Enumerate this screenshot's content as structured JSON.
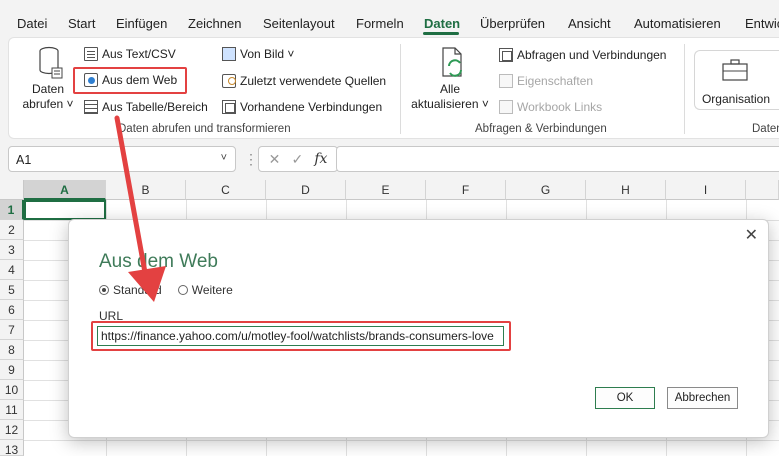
{
  "menu": {
    "tabs": [
      "Datei",
      "Start",
      "Einfügen",
      "Zeichnen",
      "Seitenlayout",
      "Formeln",
      "Daten",
      "Überprüfen",
      "Ansicht",
      "Automatisieren",
      "Entwic"
    ],
    "active": "Daten"
  },
  "ribbon": {
    "get_data": {
      "line1": "Daten",
      "line2": "abrufen ˅"
    },
    "from_text_csv": "Aus Text/CSV",
    "from_web": "Aus dem Web",
    "from_table": "Aus Tabelle/Bereich",
    "from_picture": "Von Bild ˅",
    "recent_sources": "Zuletzt verwendete Quellen",
    "existing_connections": "Vorhandene Verbindungen",
    "group1_label": "Daten abrufen und transformieren",
    "refresh_all": {
      "line1": "Alle",
      "line2": "aktualisieren ˅"
    },
    "queries_connections": "Abfragen und Verbindungen",
    "properties": "Eigenschaften",
    "workbook_links": "Workbook Links",
    "group2_label": "Abfragen & Verbindungen",
    "organisation": "Organisation",
    "group3_label": "Daten"
  },
  "formula_bar": {
    "name_box": "A1",
    "name_box_arrow": "˅",
    "cancel": "✕",
    "enter": "✓",
    "fx": "fx"
  },
  "grid": {
    "columns": [
      "A",
      "B",
      "C",
      "D",
      "E",
      "F",
      "G",
      "H",
      "I"
    ],
    "rows": [
      "1",
      "2",
      "3",
      "4",
      "5",
      "6",
      "7",
      "8",
      "9",
      "10",
      "11",
      "12",
      "13"
    ],
    "selected_cell": "A1"
  },
  "dialog": {
    "title": "Aus dem Web",
    "close": "✕",
    "radio_standard": "Standard",
    "radio_advanced": "Weitere",
    "url_label": "URL",
    "url_value": "https://finance.yahoo.com/u/motley-fool/watchlists/brands-consumers-love",
    "ok": "OK",
    "cancel": "Abbrechen"
  },
  "colors": {
    "excel_green": "#1f6e43",
    "highlight_red": "#e34141"
  }
}
